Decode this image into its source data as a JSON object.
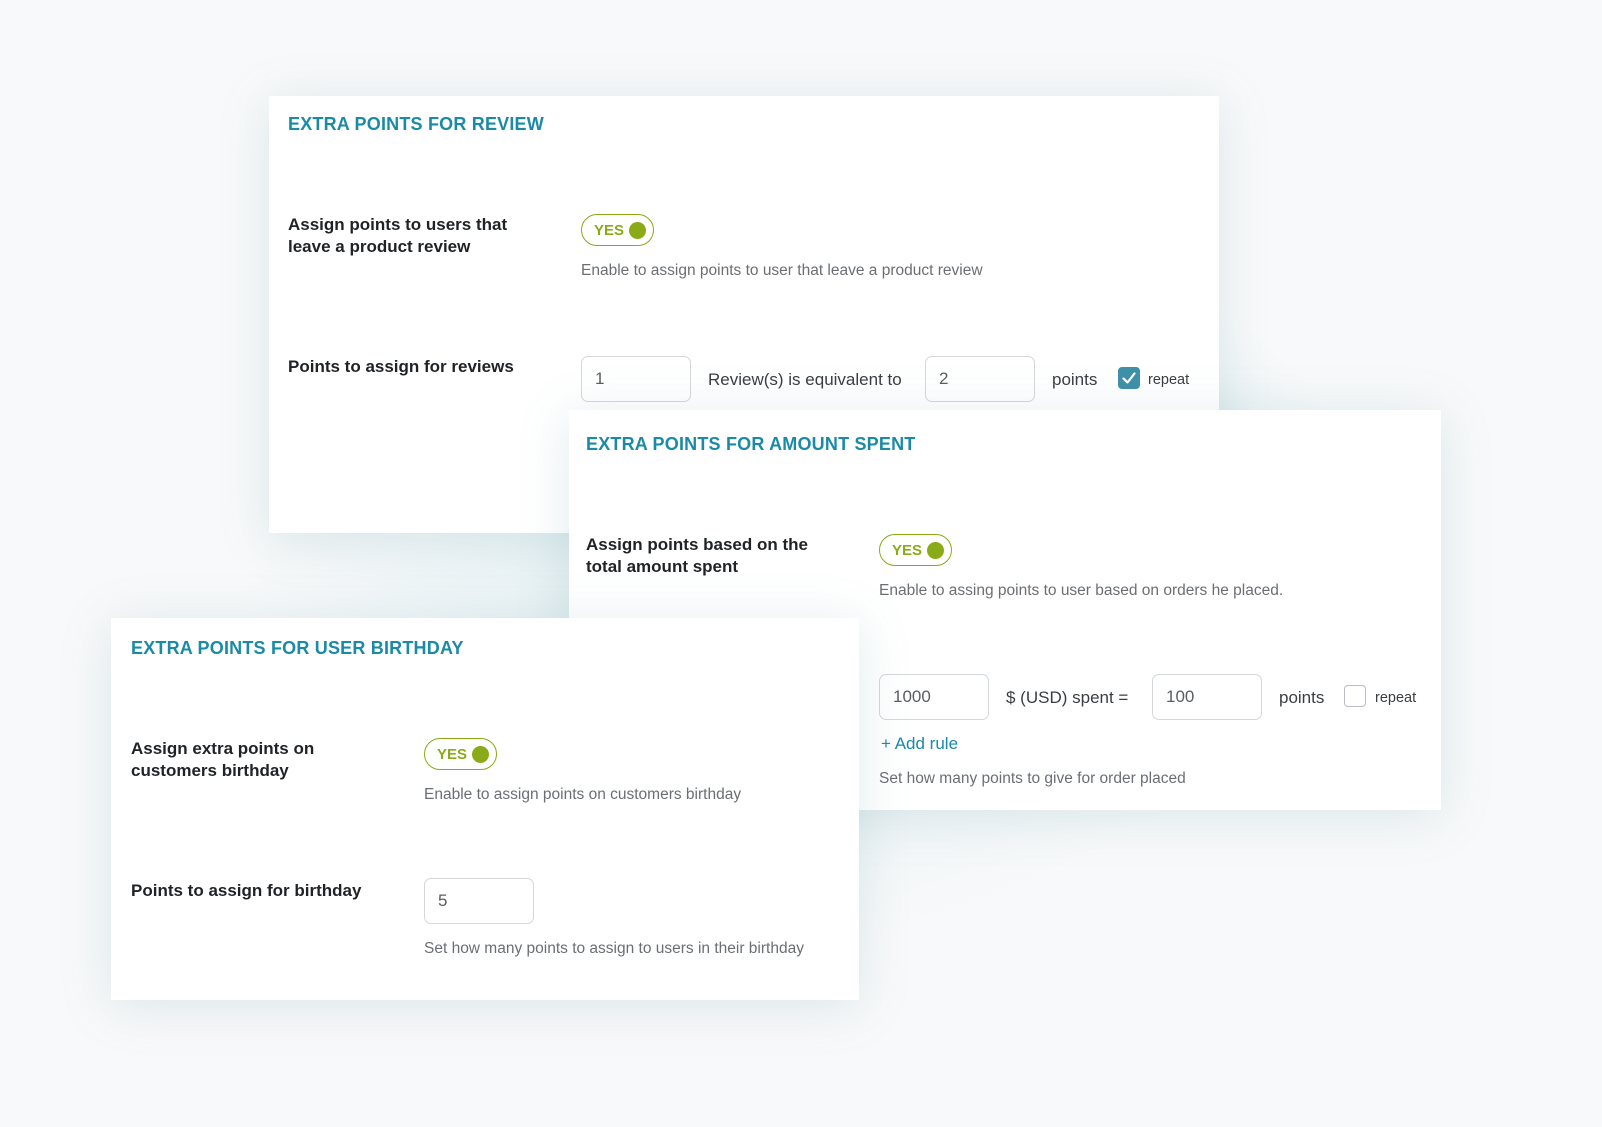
{
  "review": {
    "title": "EXTRA POINTS FOR REVIEW",
    "assign_label": "Assign points to users that leave a product review",
    "toggle_label": "YES",
    "assign_desc": "Enable to assign points to user that leave a product review",
    "points_label": "Points to assign for reviews",
    "reviews_value": "1",
    "equivalent_text": "Review(s) is equivalent to",
    "points_value": "2",
    "points_text": "points",
    "repeat_checked": true,
    "repeat_label": "repeat"
  },
  "amount": {
    "title": "EXTRA POINTS FOR AMOUNT SPENT",
    "assign_label": "Assign points based on the total amount spent",
    "toggle_label": "YES",
    "assign_desc": "Enable to assing points to user based on orders he placed.",
    "amount_value": "1000",
    "spent_text": "$ (USD) spent =",
    "points_value": "100",
    "points_text": "points",
    "repeat_checked": false,
    "repeat_label": "repeat",
    "add_rule": "+ Add rule",
    "rule_desc": "Set how many points to give for order placed"
  },
  "birthday": {
    "title": "EXTRA POINTS FOR USER BIRTHDAY",
    "assign_label": "Assign extra points on customers birthday",
    "toggle_label": "YES",
    "assign_desc": "Enable to assign points on customers birthday",
    "points_label": "Points to assign for birthday",
    "points_value": "5",
    "points_desc": "Set how many points to assign to users in their birthday"
  },
  "colors": {
    "accent": "#1a8aa6",
    "toggle_on": "#8aab17",
    "checkbox_checked": "#3f90a8"
  }
}
